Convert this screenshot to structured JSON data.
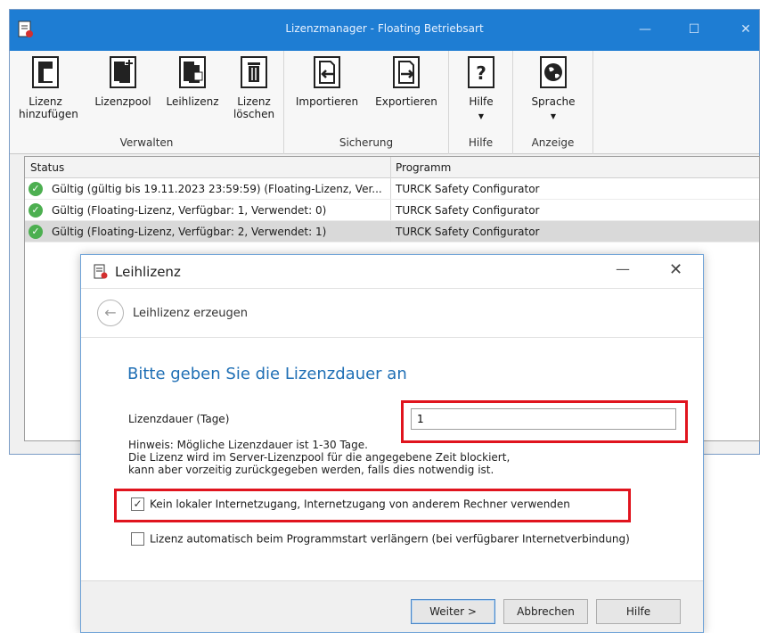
{
  "window": {
    "title": "Lizenzmanager - Floating Betriebsart",
    "min_glyph": "—",
    "max_glyph": "☐",
    "close_glyph": "✕"
  },
  "ribbon": {
    "groups": [
      {
        "label": "Verwalten",
        "buttons": [
          {
            "line1": "Lizenz",
            "line2": "hinzufügen",
            "icon": "add-license-icon"
          },
          {
            "line1": "Lizenzpool",
            "line2": "",
            "icon": "license-pool-icon"
          },
          {
            "line1": "Leihlizenz",
            "line2": "",
            "icon": "borrow-license-icon"
          },
          {
            "line1": "Lizenz",
            "line2": "löschen",
            "icon": "delete-icon"
          }
        ]
      },
      {
        "label": "Sicherung",
        "buttons": [
          {
            "line1": "Importieren",
            "line2": "",
            "icon": "import-icon"
          },
          {
            "line1": "Exportieren",
            "line2": "",
            "icon": "export-icon"
          }
        ]
      },
      {
        "label": "Hilfe",
        "buttons": [
          {
            "line1": "Hilfe",
            "line2": "",
            "icon": "help-icon"
          }
        ]
      },
      {
        "label": "Anzeige",
        "buttons": [
          {
            "line1": "Sprache",
            "line2": "",
            "icon": "globe-icon"
          }
        ]
      }
    ]
  },
  "grid": {
    "columns": [
      "Status",
      "Programm"
    ],
    "rows": [
      {
        "status": "Gültig (gültig bis 19.11.2023 23:59:59) (Floating-Lizenz, Ver...",
        "program": "TURCK Safety Configurator"
      },
      {
        "status": "Gültig (Floating-Lizenz, Verfügbar: 1, Verwendet: 0)",
        "program": "TURCK Safety Configurator"
      },
      {
        "status": "Gültig (Floating-Lizenz, Verfügbar: 2, Verwendet: 1)",
        "program": "TURCK Safety Configurator"
      }
    ]
  },
  "dialog": {
    "title": "Leihlizenz",
    "nav_title": "Leihlizenz erzeugen",
    "heading": "Bitte geben Sie die Lizenzdauer an",
    "duration_label": "Lizenzdauer (Tage)",
    "duration_value": "1",
    "hint_line1": "Hinweis: Mögliche Lizenzdauer ist 1-30 Tage.",
    "hint_line2": "Die Lizenz wird im Server-Lizenzpool für die angegebene Zeit blockiert,",
    "hint_line3": "kann aber vorzeitig zurückgegeben werden, falls dies notwendig ist.",
    "checkbox1_label": "Kein lokaler Internetzugang, Internetzugang von anderem Rechner verwenden",
    "checkbox1_checked": true,
    "checkbox2_label": "Lizenz automatisch beim Programmstart verlängern (bei verfügbarer Internetverbindung)",
    "checkbox2_checked": false,
    "buttons": {
      "next": "Weiter >",
      "cancel": "Abbrechen",
      "help": "Hilfe"
    }
  },
  "colors": {
    "titlebar": "#1e7dd3",
    "heading": "#1f6fb5",
    "highlight_box": "#e0141e",
    "status_ok": "#4caf50"
  }
}
